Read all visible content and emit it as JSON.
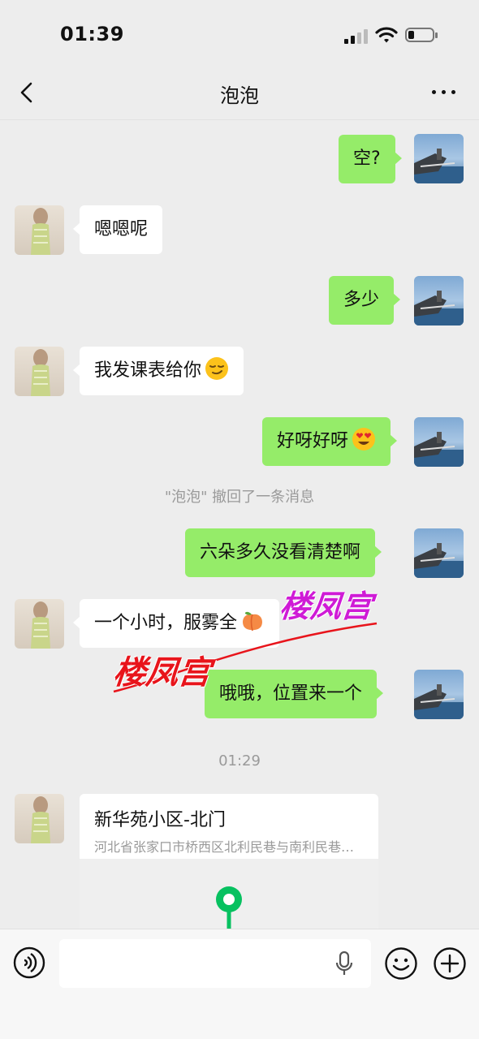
{
  "status_bar": {
    "time": "01:39",
    "battery_level": 0.25
  },
  "header": {
    "title": "泡泡",
    "back_icon": "chevron-left-icon",
    "more_icon": "more-dots-icon"
  },
  "messages": [
    {
      "side": "out",
      "text": "空?"
    },
    {
      "side": "in",
      "text": "嗯嗯呢"
    },
    {
      "side": "out",
      "text": "多少"
    },
    {
      "side": "in",
      "text": "我发课表给你",
      "emoji": "smirking-face"
    },
    {
      "side": "out",
      "text": "好呀好呀",
      "emoji": "heart-eyes-face"
    },
    {
      "side": "system",
      "text": "\"泡泡\" 撤回了一条消息"
    },
    {
      "side": "out",
      "text": "六朵多久没看清楚啊"
    },
    {
      "side": "in",
      "text": "一个小时，服雾全",
      "emoji": "peach"
    },
    {
      "side": "out",
      "text": "哦哦，位置来一个"
    },
    {
      "side": "timestamp",
      "text": "01:29"
    },
    {
      "side": "in",
      "type": "location",
      "name": "新华苑小区-北门",
      "address": "河北省张家口市桥西区北利民巷与南利民巷交叉口"
    }
  ],
  "watermark": {
    "text": "楼凤宫",
    "color_1": "#e8141b",
    "color_2": "#cf1bd6"
  },
  "input_bar": {
    "placeholder": "",
    "voice_icon": "voice-icon",
    "mic_icon": "mic-icon",
    "emoji_icon": "emoji-icon",
    "plus_icon": "plus-icon"
  },
  "colors": {
    "outgoing_bubble": "#95ec69",
    "incoming_bubble": "#ffffff",
    "background": "#ededed",
    "map_pin": "#07c160"
  }
}
